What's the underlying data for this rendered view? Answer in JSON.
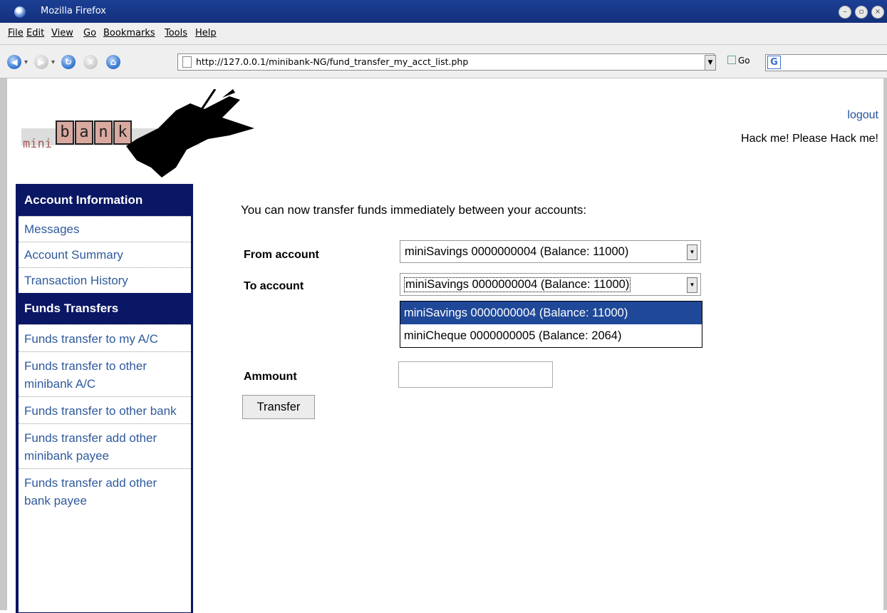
{
  "window": {
    "title": "Mozilla Firefox"
  },
  "menu": [
    "File",
    "Edit",
    "View",
    "Go",
    "Bookmarks",
    "Tools",
    "Help"
  ],
  "toolbar": {
    "url": "http://127.0.0.1/minibank-NG/fund_transfer_my_acct_list.php",
    "go_label": "Go"
  },
  "logo": {
    "mini": "mini",
    "bank_letters": [
      "b",
      "a",
      "n",
      "k"
    ]
  },
  "header": {
    "logout": "logout",
    "tagline": "Hack me! Please Hack me!"
  },
  "sidebar": {
    "section1": "Account Information",
    "items1": [
      "Messages",
      "Account Summary",
      "Transaction History"
    ],
    "section2": "Funds Transfers",
    "items2": [
      "Funds transfer to my A/C",
      "Funds transfer to other minibank A/C",
      "Funds transfer to other bank",
      "Funds transfer add other minibank payee",
      "Funds transfer add other bank payee"
    ]
  },
  "form": {
    "intro": "You can now transfer funds immediately between your accounts:",
    "from_label": "From account",
    "from_value": "miniSavings 0000000004 (Balance: 11000)",
    "to_label": "To account",
    "to_value": "miniSavings 0000000004 (Balance: 11000)",
    "options": [
      "miniSavings 0000000004 (Balance: 11000)",
      "miniCheque 0000000005 (Balance: 2064)"
    ],
    "amount_label": "Ammount",
    "amount_value": "",
    "submit": "Transfer"
  }
}
